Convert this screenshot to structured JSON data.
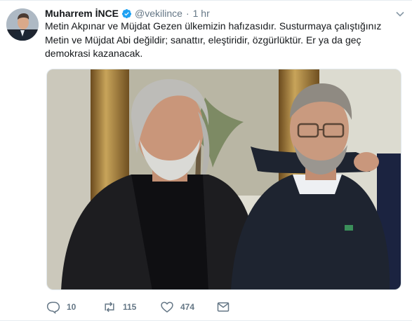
{
  "tweet": {
    "author_name": "Muharrem İNCE",
    "handle": "@vekilince",
    "separator": "·",
    "time": "1 hr",
    "text": "Metin Akpınar ve Müjdat Gezen ülkemizin hafızasıdır. Susturmaya çalıştığınız Metin ve Müjdat Abi değildir; sanattır, eleştiridir, özgürlüktür. Er ya da geç demokrasi kazanacak.",
    "counts": {
      "replies": "10",
      "retweets": "115",
      "likes": "474"
    }
  },
  "icons": {
    "verified": "verified-badge-icon",
    "caret": "chevron-down-icon",
    "reply": "reply-icon",
    "retweet": "retweet-icon",
    "like": "heart-icon",
    "message": "envelope-icon"
  },
  "colors": {
    "verified_blue": "#1da1f2",
    "secondary_text": "#657786",
    "primary_text": "#14171a"
  }
}
